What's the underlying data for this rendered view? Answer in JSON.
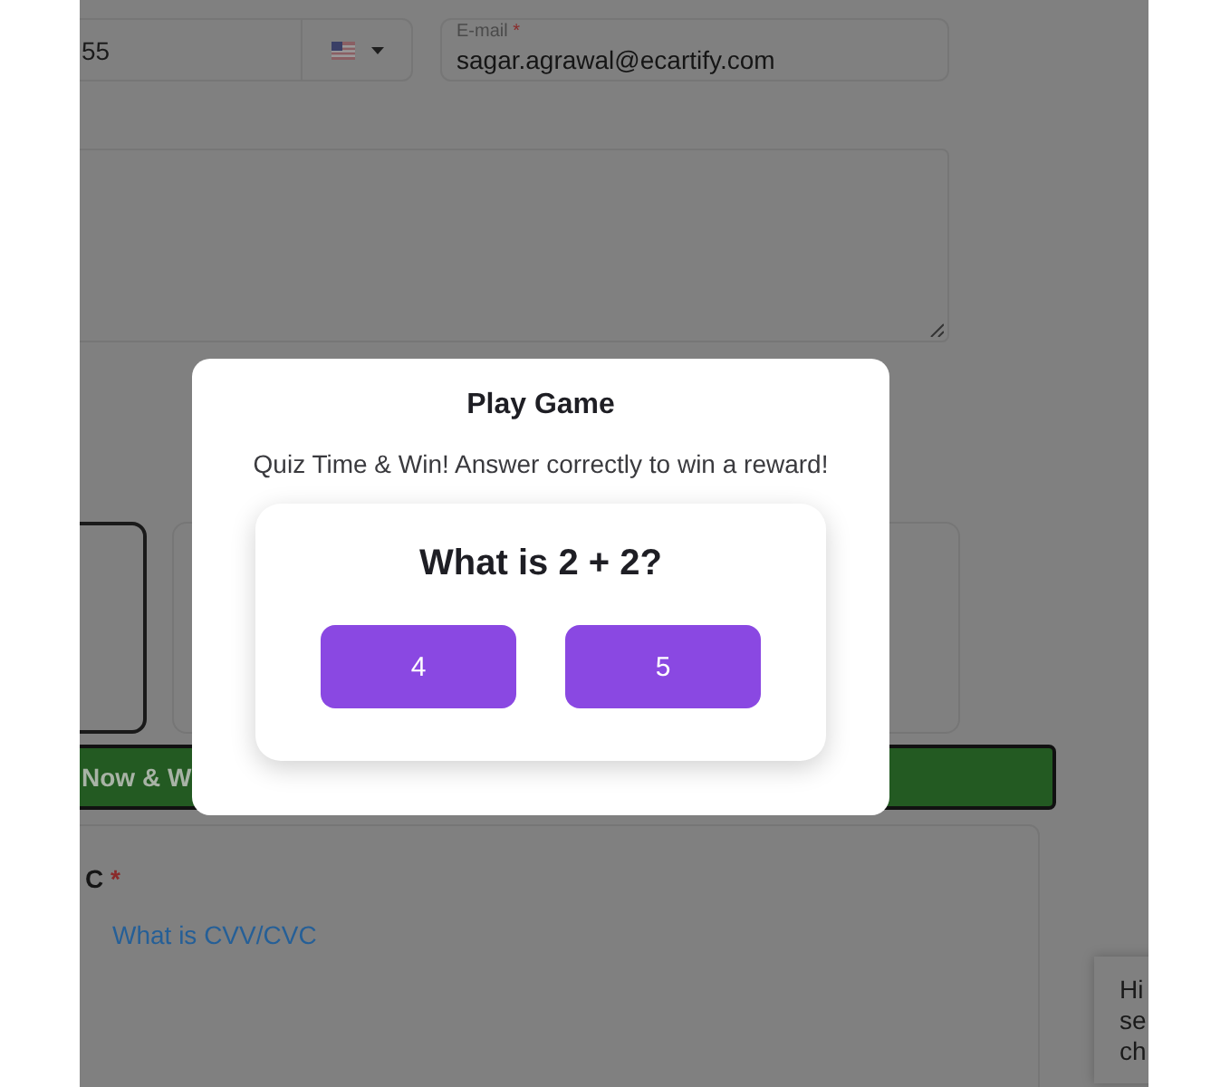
{
  "background_form": {
    "phone_field": {
      "value": "55"
    },
    "email_field": {
      "label": "E-mail",
      "required_mark": "*",
      "value": "sagar.agrawal@ecartify.com"
    },
    "payment_options": [
      {
        "selected": true
      },
      {
        "selected": false
      }
    ],
    "submit_button": {
      "label": "Now & W"
    },
    "cvv_section": {
      "label": "C",
      "required_mark": "*",
      "link": "What is CVV/CVC"
    }
  },
  "modal": {
    "title": "Play Game",
    "subtitle": "Quiz Time & Win! Answer correctly to win a reward!",
    "question": "What is 2 + 2?",
    "answers": [
      {
        "label": "4"
      },
      {
        "label": "5"
      }
    ]
  },
  "chat_bubble": {
    "lines": [
      "Hi",
      "se",
      "ch"
    ]
  }
}
